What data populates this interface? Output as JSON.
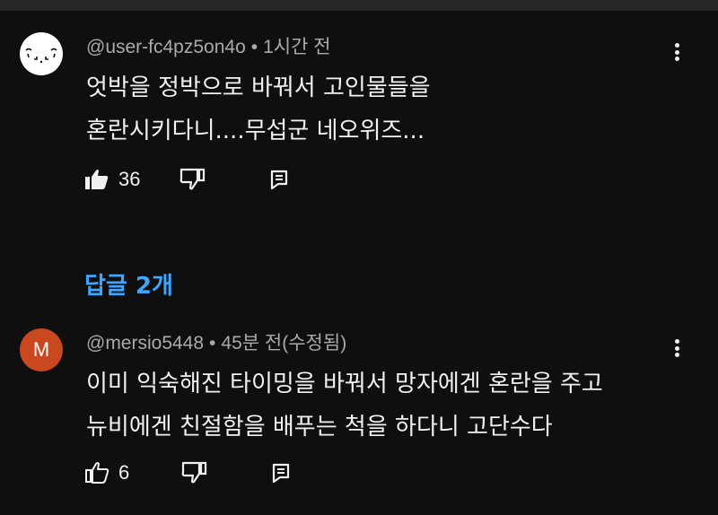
{
  "comments": [
    {
      "handle": "@user-fc4pz5on4o",
      "time": "1시간 전",
      "lines": [
        "엇박을 정박으로 바꿔서 고인물들을",
        "혼란시키다니....무섭군 네오위즈..."
      ],
      "likes": "36",
      "liked": true,
      "avatar_letter": ""
    },
    {
      "handle": "@mersio5448",
      "time": "45분 전(수정됨)",
      "lines": [
        "이미 익숙해진 타이밍을 바꿔서 망자에겐 혼란을 주고",
        "뉴비에겐 친절함을 배푸는 척을 하다니 고단수다"
      ],
      "likes": "6",
      "liked": false,
      "avatar_letter": "M"
    }
  ],
  "replies_label": "답글 2개",
  "colors": {
    "background": "#0f0f0f",
    "link": "#3ea6ff",
    "avatar_m": "#c9481f"
  },
  "icons": [
    "thumbs-up-icon",
    "thumbs-down-icon",
    "reply-icon",
    "more-vert-icon"
  ]
}
